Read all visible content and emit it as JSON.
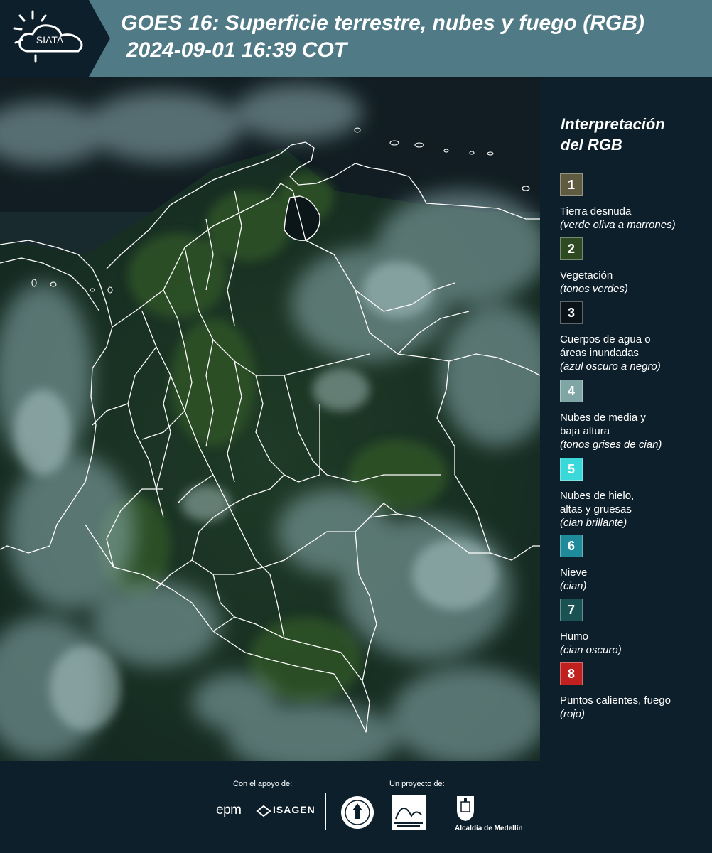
{
  "header": {
    "logo_text": "SIATA",
    "title_line1": "GOES 16: Superficie terrestre, nubes y fuego (RGB)",
    "title_line2": "2024-09-01 16:39 COT"
  },
  "legend": {
    "title_line1": "Interpretación",
    "title_line2": "del RGB",
    "items": [
      {
        "number": "1",
        "color": "#5e5b40",
        "label": "Tierra desnuda",
        "note": "(verde oliva a marrones)"
      },
      {
        "number": "2",
        "color": "#2e4a22",
        "label": "Vegetación",
        "note": "(tonos verdes)"
      },
      {
        "number": "3",
        "color": "#0a1418",
        "label": "Cuerpos de agua o áreas inundadas",
        "note": "(azul oscuro a negro)"
      },
      {
        "number": "4",
        "color": "#7fa5a5",
        "label": "Nubes de media y baja altura",
        "note": "(tonos grises de cian)"
      },
      {
        "number": "5",
        "color": "#3ad8d8",
        "label": "Nubes de hielo, altas y gruesas",
        "note": "(cian brillante)"
      },
      {
        "number": "6",
        "color": "#1f8a9a",
        "label": "Nieve",
        "note": "(cian)"
      },
      {
        "number": "7",
        "color": "#1a5253",
        "label": "Humo",
        "note": "(cian oscuro)"
      },
      {
        "number": "8",
        "color": "#c0201f",
        "label": "Puntos calientes, fuego",
        "note": "(rojo)"
      }
    ]
  },
  "footer": {
    "support_caption": "Con el apoyo de:",
    "project_caption": "Un proyecto de:",
    "epm_text": "epm",
    "isagen_text": "ISAGEN",
    "alcaldia_text": "Alcaldía de Medellín"
  }
}
